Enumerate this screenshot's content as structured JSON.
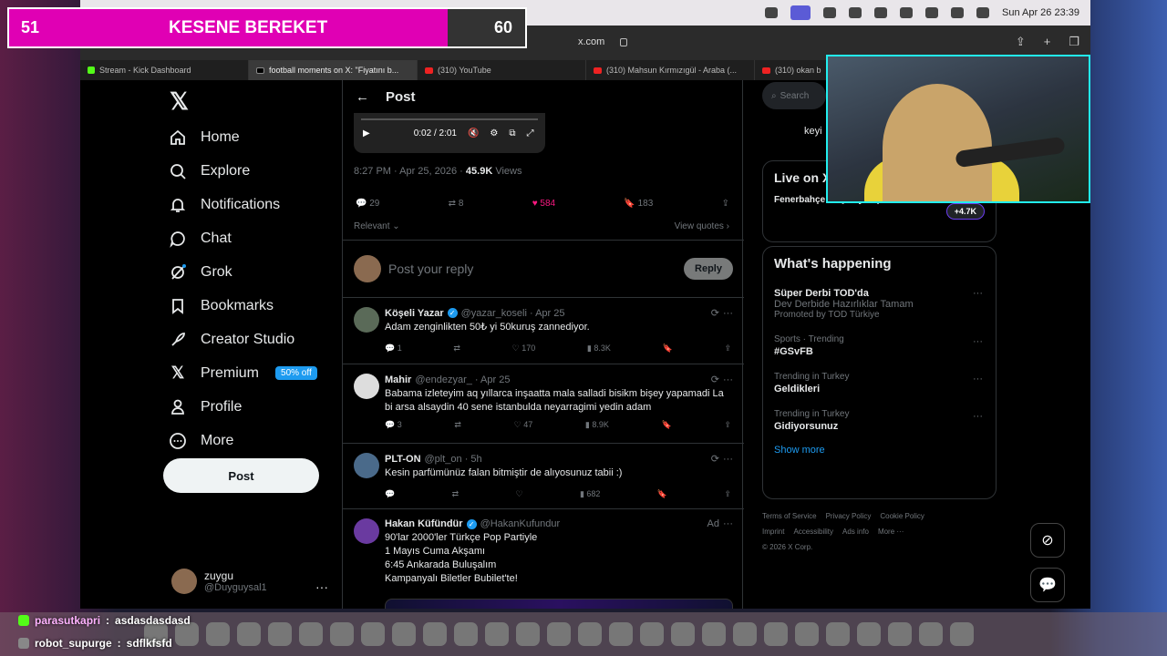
{
  "overlay": {
    "left": "51",
    "title": "KESENE BEREKET",
    "right": "60",
    "progress": 0.85
  },
  "menubar": {
    "datetime": "Sun Apr 26  23:39"
  },
  "browser": {
    "url": "x.com"
  },
  "tabs": [
    {
      "label": "Stream - Kick Dashboard",
      "icon": "kick-icon"
    },
    {
      "label": "football moments on X: \"Fiyatını b...",
      "icon": "x-icon"
    },
    {
      "label": "(310) YouTube",
      "icon": "youtube-icon"
    },
    {
      "label": "(310) Mahsun Kırmızıgül - Araba (...",
      "icon": "youtube-icon"
    },
    {
      "label": "(310) okan b",
      "icon": "youtube-icon"
    }
  ],
  "nav": {
    "items": [
      {
        "label": "Home",
        "icon": "home-icon"
      },
      {
        "label": "Explore",
        "icon": "search-icon"
      },
      {
        "label": "Notifications",
        "icon": "bell-icon"
      },
      {
        "label": "Chat",
        "icon": "chat-bubble-icon"
      },
      {
        "label": "Grok",
        "icon": "grok-icon"
      },
      {
        "label": "Bookmarks",
        "icon": "bookmark-icon"
      },
      {
        "label": "Creator Studio",
        "icon": "rocket-icon"
      },
      {
        "label": "Premium",
        "icon": "x-logo-icon",
        "badge": "50% off"
      },
      {
        "label": "Profile",
        "icon": "person-icon"
      },
      {
        "label": "More",
        "icon": "more-circle-icon"
      }
    ],
    "post": "Post",
    "user": {
      "name": "zuygu",
      "handle": "@Duyguysal1"
    }
  },
  "post": {
    "header": "Post",
    "video_time": "0:02 / 2:01",
    "timestamp": "8:27 PM · Apr 25, 2026 · ",
    "views": "45.9K",
    "views_label": " Views",
    "replies": "29",
    "reposts": "8",
    "likes": "584",
    "bookmarks": "183",
    "sort": "Relevant",
    "view_quotes": "View quotes",
    "reply_placeholder": "Post your reply",
    "reply_button": "Reply"
  },
  "replies": [
    {
      "name": "Köşeli Yazar",
      "verified": true,
      "handle": "@yazar_koseli · Apr 25",
      "text": "Adam zenginlikten 50₺ yi 50kuruş zannediyor.",
      "replies": "1",
      "reposts": "",
      "likes": "170",
      "views": "8.3K"
    },
    {
      "name": "Mahir",
      "verified": false,
      "handle": "@endezyar_ · Apr 25",
      "text": "Babama izleteyim aq yıllarca inşaatta mala salladi bisikm bişey yapamadi La bi arsa alsaydin 40 sene istanbulda neyarragimi yedin adam",
      "replies": "3",
      "reposts": "",
      "likes": "47",
      "views": "8.9K"
    },
    {
      "name": "PLT-ON",
      "verified": false,
      "handle": "@plt_on · 5h",
      "text": "Kesin parfümünüz falan bitmiştir de alıyosunuz tabii :)",
      "replies": "",
      "reposts": "",
      "likes": "",
      "views": "682"
    },
    {
      "name": "Hakan Küfündür",
      "verified": true,
      "handle": "@HakanKufundur",
      "ad": "Ad",
      "text": "90'lar 2000'ler Türkçe Pop Partiyle\n1 Mayıs Cuma Akşamı\n6:45 Ankarada Buluşalım\nKampanyalı Biletler Bubilet'te!"
    }
  ],
  "right": {
    "search": "Search",
    "peek": "keyi",
    "live_title": "Live on X",
    "live_stream": "Fenerbahçe Maç Yayını | İstafa",
    "live_count": "+4.7K",
    "happening_title": "What's happening",
    "trends": [
      {
        "meta": "",
        "title": "Süper Derbi TOD'da",
        "sub": "Dev Derbide Hazırlıklar Tamam",
        "promo": "Promoted by TOD Türkiye"
      },
      {
        "meta": "Sports · Trending",
        "title": "#GSvFB"
      },
      {
        "meta": "Trending in Turkey",
        "title": "Geldikleri"
      },
      {
        "meta": "Trending in Turkey",
        "title": "Gidiyorsunuz"
      }
    ],
    "show_more": "Show more",
    "footer": [
      "Terms of Service",
      "Privacy Policy",
      "Cookie Policy",
      "Imprint",
      "Accessibility",
      "Ads info",
      "More ···",
      "© 2026 X Corp."
    ]
  },
  "chat": [
    {
      "user": "parasutkapri",
      "message": "asdasdasdasd"
    },
    {
      "user": "robot_supurge",
      "message": "sdflkfsfd"
    }
  ]
}
